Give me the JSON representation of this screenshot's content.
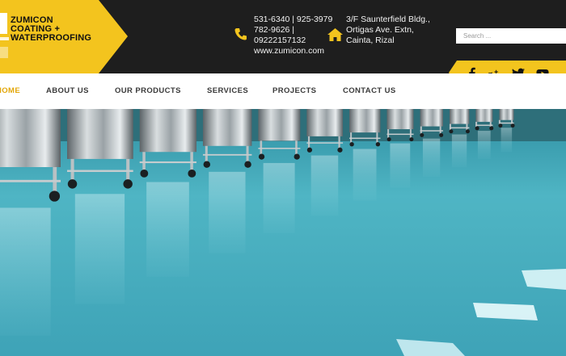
{
  "brand": {
    "lines": [
      "ZUMICON",
      "COATING +",
      "WATERPROOFING"
    ],
    "accent": "#f3c41e"
  },
  "contact": {
    "phone_lines": [
      "531-6340 | 925-3979",
      "782-9626 |",
      "09222157132",
      "www.zumicon.com"
    ],
    "address_lines": [
      "3/F Saunterfield Bldg.,",
      "Ortigas Ave. Extn,",
      "Cainta, Rizal"
    ],
    "icons": [
      "phone-icon",
      "home-icon"
    ]
  },
  "search": {
    "placeholder": "Search ..."
  },
  "social": [
    "facebook-icon",
    "google-plus-icon",
    "twitter-icon",
    "youtube-icon"
  ],
  "nav": {
    "items": [
      {
        "label": "HOME",
        "active": true
      },
      {
        "label": "ABOUT US"
      },
      {
        "label": "OUR PRODUCTS"
      },
      {
        "label": "SERVICES"
      },
      {
        "label": "PROJECTS"
      },
      {
        "label": "CONTACT US"
      }
    ]
  },
  "hero": {
    "floor_color": "#4fb5c4"
  }
}
